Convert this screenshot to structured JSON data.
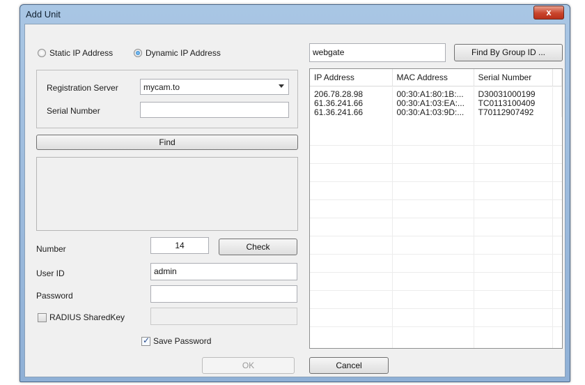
{
  "window": {
    "title": "Add Unit",
    "close_label": "x"
  },
  "address_mode": {
    "static_label": "Static IP Address",
    "dynamic_label": "Dynamic IP Address",
    "selected": "dynamic"
  },
  "registration": {
    "server_label": "Registration Server",
    "server_value": "mycam.to",
    "serial_label": "Serial Number",
    "serial_value": ""
  },
  "find_label": "Find",
  "form": {
    "number_label": "Number",
    "number_value": "14",
    "check_label": "Check",
    "userid_label": "User ID",
    "userid_value": "admin",
    "password_label": "Password",
    "password_value": "",
    "radius_label": "RADIUS SharedKey",
    "radius_checked": false,
    "save_password_label": "Save Password",
    "save_password_checked": true
  },
  "ok_label": "OK",
  "cancel_label": "Cancel",
  "group_search": {
    "value": "webgate",
    "button_label": "Find By Group ID ..."
  },
  "results": {
    "columns": [
      "IP Address",
      "MAC Address",
      "Serial Number"
    ],
    "rows": [
      [
        "206.78.28.98",
        "00:30:A1:80:1B:...",
        "D30031000199"
      ],
      [
        "61.36.241.66",
        "00:30:A1:03:EA:...",
        "TC0113100409"
      ],
      [
        "61.36.241.66",
        "00:30:A1:03:9D:...",
        "T70112907492"
      ]
    ]
  }
}
